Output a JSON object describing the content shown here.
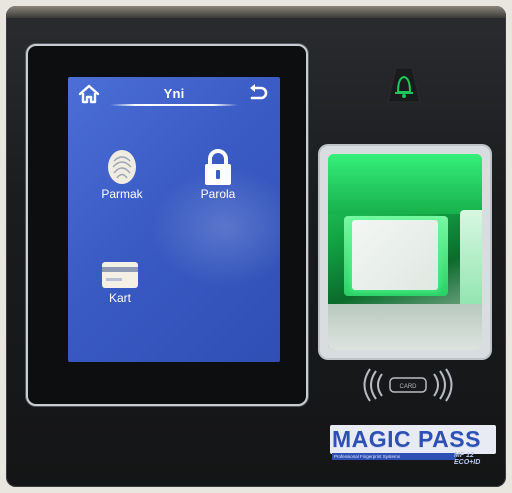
{
  "screen": {
    "title": "Yni",
    "tiles": [
      {
        "label": "Parmak",
        "icon": "fingerprint-icon"
      },
      {
        "label": "Parola",
        "icon": "padlock-icon"
      },
      {
        "label": "Kart",
        "icon": "card-icon"
      }
    ],
    "home_icon": "home-icon",
    "back_icon": "back-arrow-icon"
  },
  "device": {
    "bell_icon": "bell-icon",
    "card_reader_label": "CARD",
    "brand_name": "MAGIC PASS",
    "brand_tagline": "Professional Fingerprint Systems",
    "model": "MF 12 ECO+ID"
  },
  "colors": {
    "screen_blue": "#3a5bc4",
    "sensor_green": "#2ee06a",
    "brand_blue": "#2e4fb4"
  }
}
